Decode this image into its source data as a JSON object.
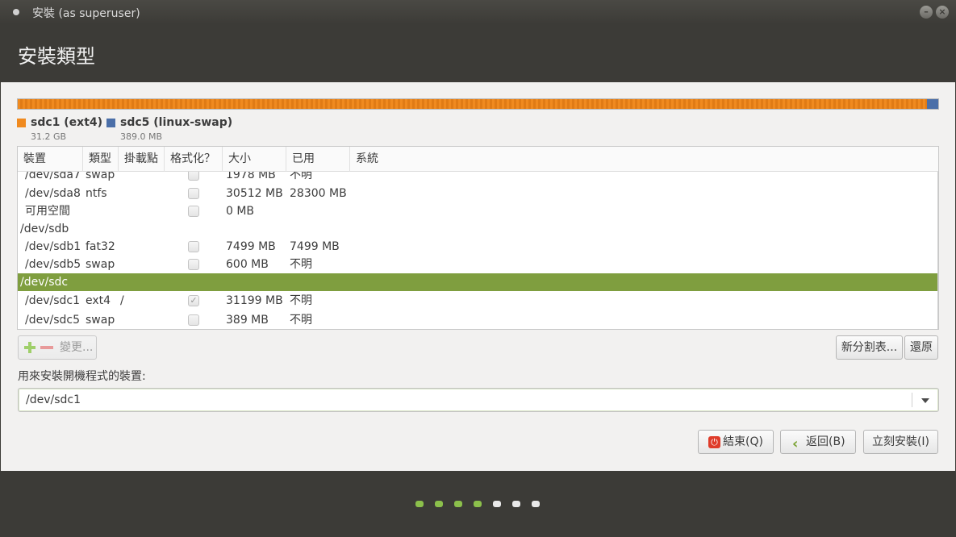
{
  "window": {
    "title": "安裝 (as superuser)",
    "min_icon": "minimize-icon",
    "close_icon": "close-icon"
  },
  "header": {
    "title": "安裝類型"
  },
  "partition_bar": {
    "segments": [
      {
        "name": "sdc1 (ext4)",
        "size": "31.2 GB",
        "color": "#f08a1f"
      },
      {
        "name": "sdc5 (linux-swap)",
        "size": "389.0 MB",
        "color": "#4b6fa8"
      }
    ]
  },
  "table": {
    "columns": [
      "裝置",
      "類型",
      "掛載點",
      "格式化？",
      "大小",
      "已用",
      "系統"
    ],
    "rows": [
      {
        "device": "/dev/sda7",
        "type": "swap",
        "mount": "",
        "format": false,
        "size": "1978 MB",
        "used": "不明",
        "system": "",
        "checkbox": true
      },
      {
        "device": "/dev/sda8",
        "type": "ntfs",
        "mount": "",
        "format": false,
        "size": "30512 MB",
        "used": "28300 MB",
        "system": "",
        "checkbox": true
      },
      {
        "device": "可用空間",
        "type": "",
        "mount": "",
        "format": false,
        "size": "0 MB",
        "used": "",
        "system": "",
        "checkbox": true
      },
      {
        "device": "/dev/sdb",
        "type": "",
        "mount": "",
        "format": false,
        "size": "",
        "used": "",
        "system": "",
        "checkbox": false
      },
      {
        "device": "/dev/sdb1",
        "type": "fat32",
        "mount": "",
        "format": false,
        "size": "7499 MB",
        "used": "7499 MB",
        "system": "",
        "checkbox": true
      },
      {
        "device": "/dev/sdb5",
        "type": "swap",
        "mount": "",
        "format": false,
        "size": "600 MB",
        "used": "不明",
        "system": "",
        "checkbox": true
      },
      {
        "device": "/dev/sdc",
        "type": "",
        "mount": "",
        "format": false,
        "size": "",
        "used": "",
        "system": "",
        "checkbox": false,
        "selected": true
      },
      {
        "device": "/dev/sdc1",
        "type": "ext4",
        "mount": "/",
        "format": true,
        "size": "31199 MB",
        "used": "不明",
        "system": "",
        "checkbox": true
      },
      {
        "device": "/dev/sdc5",
        "type": "swap",
        "mount": "",
        "format": false,
        "size": "389 MB",
        "used": "不明",
        "system": "",
        "checkbox": true
      }
    ]
  },
  "toolbar": {
    "add_icon": "plus-icon",
    "remove_icon": "minus-icon",
    "change_label": "變更..."
  },
  "buttons": {
    "new_table": "新分割表...",
    "revert": "還原",
    "quit": "結束(Q)",
    "back": "返回(B)",
    "install_now": "立刻安裝(I)"
  },
  "bootloader": {
    "label": "用來安裝開機程式的裝置:",
    "value": "/dev/sdc1"
  },
  "progress": {
    "total": 7,
    "completed": 4,
    "active_color": "#8cc04b"
  }
}
